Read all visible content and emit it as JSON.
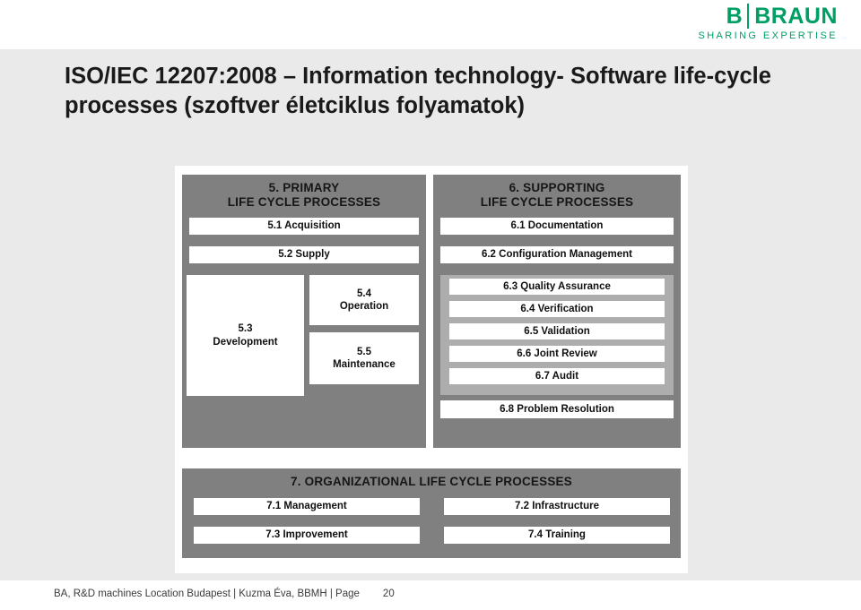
{
  "logo": {
    "brand_first": "B",
    "brand_second": "BRAUN",
    "tagline": "SHARING EXPERTISE",
    "color": "#00a064"
  },
  "slide": {
    "title_line1": "ISO/IEC 12207:2008 – Information technology- Software life-cycle",
    "title_line2": "processes   (szoftver életciklus folyamatok)",
    "background_color": "#eaeaea",
    "panel_color": "#ffffff"
  },
  "diagram": {
    "group_color": "#808080",
    "subgroup_color": "#adadad",
    "box_color": "#ffffff",
    "primary": {
      "title_line1": "5. PRIMARY",
      "title_line2": "LIFE CYCLE PROCESSES",
      "items": [
        {
          "label": "5.1 Acquisition"
        },
        {
          "label": "5.2 Supply"
        },
        {
          "label": "5.3\nDevelopment"
        },
        {
          "label": "5.4\nOperation"
        },
        {
          "label": "5.5\nMaintenance"
        }
      ]
    },
    "supporting": {
      "title_line1": "6. SUPPORTING",
      "title_line2": "LIFE CYCLE PROCESSES",
      "items": [
        {
          "label": "6.1 Documentation"
        },
        {
          "label": "6.2 Configuration Management"
        },
        {
          "label": "6.3 Quality Assurance"
        },
        {
          "label": "6.4 Verification"
        },
        {
          "label": "6.5 Validation"
        },
        {
          "label": "6.6 Joint Review"
        },
        {
          "label": "6.7 Audit"
        },
        {
          "label": "6.8 Problem Resolution"
        }
      ]
    },
    "organizational": {
      "title": "7. ORGANIZATIONAL LIFE CYCLE PROCESSES",
      "items": [
        {
          "label": "7.1 Management"
        },
        {
          "label": "7.2 Infrastructure"
        },
        {
          "label": "7.3 Improvement"
        },
        {
          "label": "7.4 Training"
        }
      ]
    }
  },
  "footer": {
    "text": "BA, R&D machines Location Budapest | Kuzma Éva, BBMH | Page",
    "page_number": "20"
  }
}
